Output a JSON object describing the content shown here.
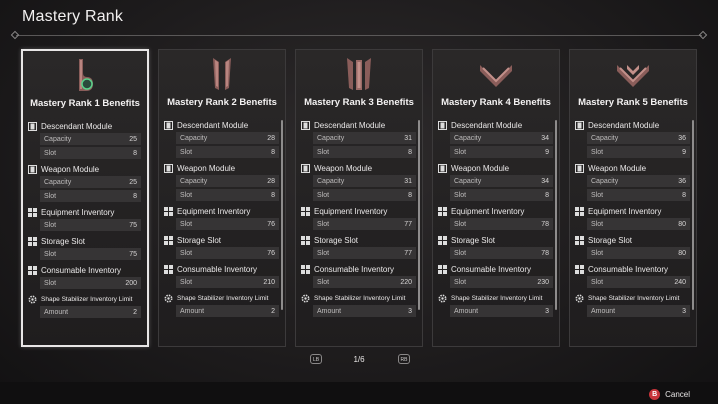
{
  "header": {
    "title": "Mastery Rank"
  },
  "labels": {
    "descendant_module": "Descendant Module",
    "weapon_module": "Weapon Module",
    "equipment_inventory": "Equipment Inventory",
    "storage_slot": "Storage Slot",
    "consumable_inventory": "Consumable Inventory",
    "shape_stabilizer": "Shape Stabilizer Inventory Limit",
    "capacity": "Capacity",
    "slot": "Slot",
    "amount": "Amount"
  },
  "cards": [
    {
      "title": "Mastery Rank 1 Benefits",
      "descendant_capacity": "25",
      "descendant_slot": "8",
      "weapon_capacity": "25",
      "weapon_slot": "8",
      "equipment_slot": "75",
      "storage_slot": "75",
      "consumable_slot": "200",
      "stabilizer_amount": "2"
    },
    {
      "title": "Mastery Rank 2 Benefits",
      "descendant_capacity": "28",
      "descendant_slot": "8",
      "weapon_capacity": "28",
      "weapon_slot": "8",
      "equipment_slot": "76",
      "storage_slot": "76",
      "consumable_slot": "210",
      "stabilizer_amount": "2"
    },
    {
      "title": "Mastery Rank 3 Benefits",
      "descendant_capacity": "31",
      "descendant_slot": "8",
      "weapon_capacity": "31",
      "weapon_slot": "8",
      "equipment_slot": "77",
      "storage_slot": "77",
      "consumable_slot": "220",
      "stabilizer_amount": "3"
    },
    {
      "title": "Mastery Rank 4 Benefits",
      "descendant_capacity": "34",
      "descendant_slot": "9",
      "weapon_capacity": "34",
      "weapon_slot": "8",
      "equipment_slot": "78",
      "storage_slot": "78",
      "consumable_slot": "230",
      "stabilizer_amount": "3"
    },
    {
      "title": "Mastery Rank 5 Benefits",
      "descendant_capacity": "36",
      "descendant_slot": "9",
      "weapon_capacity": "36",
      "weapon_slot": "8",
      "equipment_slot": "80",
      "storage_slot": "80",
      "consumable_slot": "240",
      "stabilizer_amount": "3"
    }
  ],
  "pager": {
    "prev_label": "LB",
    "next_label": "RB",
    "page": "1/6"
  },
  "footer": {
    "cancel_badge": "B",
    "cancel_label": "Cancel"
  },
  "colors": {
    "accent_red": "#c8343a",
    "active_border": "#e8e6e6",
    "card_bg": "#242223"
  }
}
